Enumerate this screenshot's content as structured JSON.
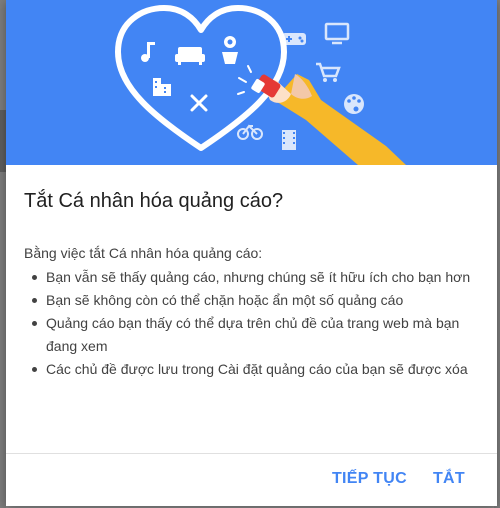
{
  "dialog": {
    "title": "Tắt Cá nhân hóa quảng cáo?",
    "intro": "Bằng việc tắt Cá nhân hóa quảng cáo:",
    "bullets": [
      "Bạn vẫn sẽ thấy quảng cáo, nhưng chúng sẽ ít hữu ích cho bạn hơn",
      "Bạn sẽ không còn có thể chặn hoặc ẩn một số quảng cáo",
      "Quảng cáo bạn thấy có thể dựa trên chủ đề của trang web mà bạn đang xem",
      "Các chủ đề được lưu trong Cài đặt quảng cáo của bạn sẽ được xóa"
    ],
    "continue_label": "TIẾP TỤC",
    "off_label": "TẮT"
  },
  "hero": {
    "background": "#4285f4",
    "icons": [
      "music-note-icon",
      "sofa-icon",
      "flower-pot-icon",
      "city-icon",
      "cutlery-icon",
      "gamepad-icon",
      "tv-icon",
      "shopping-cart-icon",
      "palette-icon",
      "bicycle-icon",
      "film-icon"
    ]
  },
  "colors": {
    "accent": "#4285f4",
    "arm": "#f5c842",
    "eraser": "#e53935"
  }
}
